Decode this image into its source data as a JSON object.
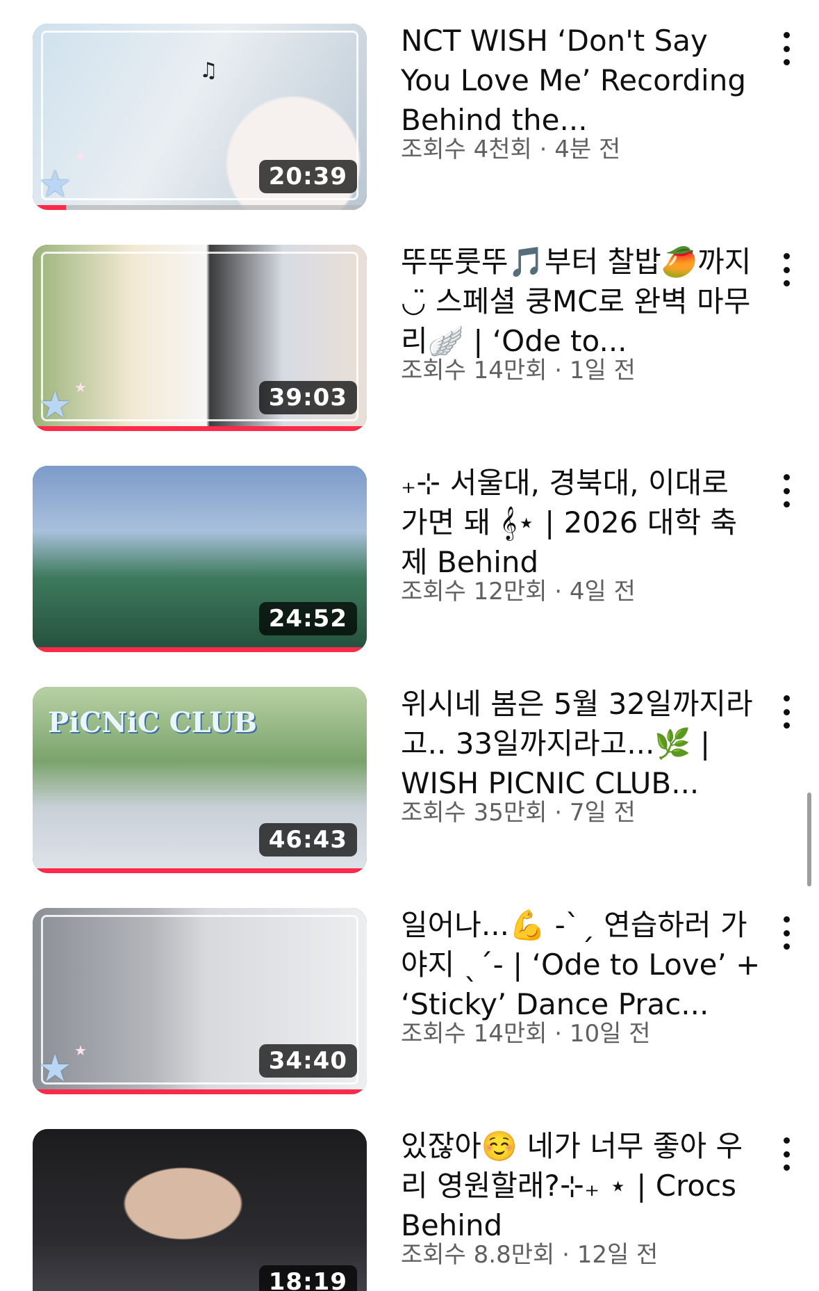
{
  "videos": [
    {
      "title": "NCT WISH ‘Don't Say You Love Me’ Recording Behind the...",
      "stats": "조회수 4천회 · 4분 전",
      "duration": "20:39",
      "progress": 0.1,
      "theme": "art1"
    },
    {
      "title": "뚜뚜룻뚜🎵부터 찰밥🥭까지◡̈ 스페셜 쿵MC로 완벽 마무리🪽 | ‘Ode to...",
      "stats": "조회수 14만회 · 1일 전",
      "duration": "39:03",
      "progress": 1.0,
      "theme": "art2"
    },
    {
      "title": "₊⊹ 서울대, 경북대, 이대로 가면 돼 𝄞⋆ | 2026 대학 축제 Behind",
      "stats": "조회수 12만회 · 4일 전",
      "duration": "24:52",
      "progress": 1.0,
      "theme": "art3"
    },
    {
      "title": "위시네 봄은 5월 32일까지라고.. 33일까지라고...🌿 | WISH PICNIC CLUB...",
      "stats": "조회수 35만회 · 7일 전",
      "duration": "46:43",
      "progress": 1.0,
      "theme": "art4"
    },
    {
      "title": "일어나...💪 -ˋˏ 연습하러 가야지 ˎˊ- | ‘Ode to Love’ + ‘Sticky’ Dance Prac...",
      "stats": "조회수 14만회 · 10일 전",
      "duration": "34:40",
      "progress": 1.0,
      "theme": "art5"
    },
    {
      "title": "있잖아☺️ 네가 너무 좋아 우리 영원할래?⊹₊ ⋆ | Crocs Behind",
      "stats": "조회수 8.8만회 · 12일 전",
      "duration": "18:19",
      "progress": 0,
      "theme": "art6"
    }
  ],
  "thumb_overlays": {
    "picnic_logo": "PiCNiC CLUB"
  },
  "icons": {
    "more": "more-vert-icon",
    "star": "star-icon",
    "note": "music-note-icon"
  },
  "colors": {
    "progress_fill": "#ff2a4a",
    "stats_text": "#606060",
    "title_text": "#0f0f0f"
  }
}
